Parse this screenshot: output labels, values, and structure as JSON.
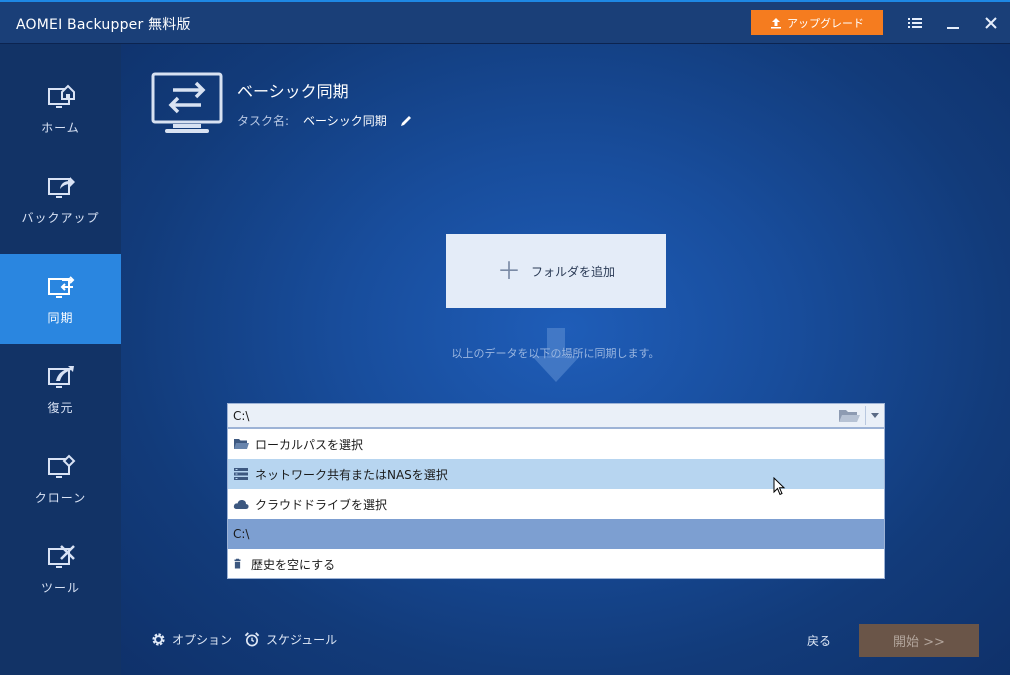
{
  "window": {
    "title": "AOMEI Backupper 無料版"
  },
  "toolbar": {
    "upgrade_label": "アップグレード"
  },
  "sidebar": {
    "items": [
      {
        "label": "ホーム",
        "icon": "home-monitor-icon"
      },
      {
        "label": "バックアップ",
        "icon": "backup-monitor-icon"
      },
      {
        "label": "同期",
        "icon": "sync-monitor-icon",
        "active": true
      },
      {
        "label": "復元",
        "icon": "restore-monitor-icon"
      },
      {
        "label": "クローン",
        "icon": "clone-monitor-icon"
      },
      {
        "label": "ツール",
        "icon": "tools-monitor-icon"
      }
    ]
  },
  "header": {
    "task_type": "ベーシック同期",
    "task_name_label": "タスク名:",
    "task_name_value": "ベーシック同期"
  },
  "source": {
    "add_folder_label": "フォルダを追加"
  },
  "hint": "以上のデータを以下の場所に同期します。",
  "destination": {
    "value": "C:\\",
    "dropdown": [
      {
        "label": "ローカルパスを選択",
        "icon": "folder-open-icon"
      },
      {
        "label": "ネットワーク共有またはNASを選択",
        "icon": "nas-server-icon",
        "state": "hover"
      },
      {
        "label": "クラウドドライブを選択",
        "icon": "cloud-icon"
      },
      {
        "label": "C:\\",
        "state": "selected"
      },
      {
        "label": "歴史を空にする",
        "icon": "trash-icon"
      }
    ]
  },
  "footer": {
    "options_label": "オプション",
    "schedule_label": "スケジュール",
    "back_label": "戻る",
    "start_label": "開始 >>"
  },
  "colors": {
    "accent": "#2a86e0",
    "upgrade": "#f57c1f",
    "start_disabled": "#6a5548",
    "dropdown_hover": "#b7d5f0",
    "dropdown_selected": "#7d9fd1"
  }
}
